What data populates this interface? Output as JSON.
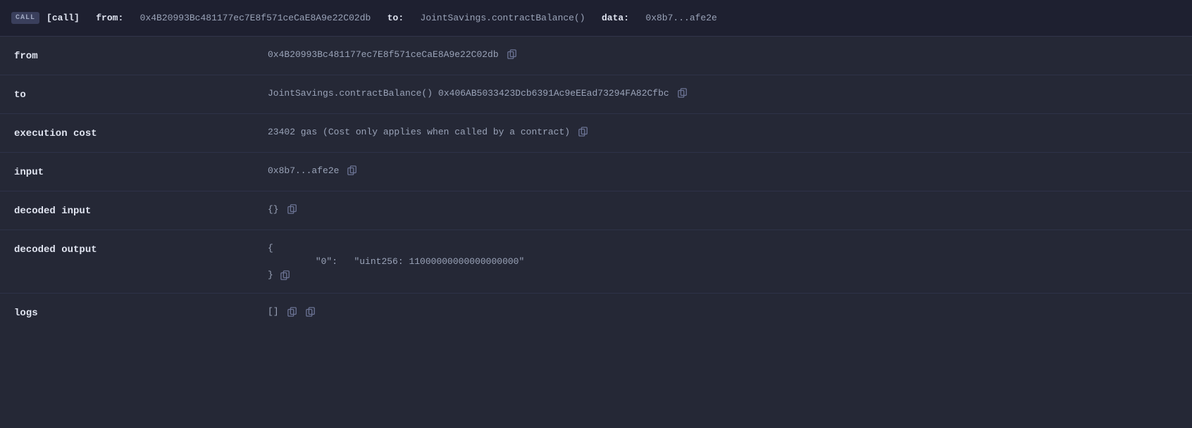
{
  "header": {
    "badge": "CALL",
    "label_call": "[call]",
    "label_from": "from:",
    "from_address": "0x4B20993Bc481177ec7E8f571ceCaE8A9e22C02db",
    "label_to": "to:",
    "to_value": "JointSavings.contractBalance()",
    "label_data": "data:",
    "data_value": "0x8b7...afe2e"
  },
  "rows": {
    "from": {
      "label": "from",
      "value": "0x4B20993Bc481177ec7E8f571ceCaE8A9e22C02db"
    },
    "to": {
      "label": "to",
      "value": "JointSavings.contractBalance()  0x406AB5033423Dcb6391Ac9eEEad73294FA82Cfbc"
    },
    "to_func": "JointSavings.contractBalance()",
    "to_addr": "0x406AB5033423Dcb6391Ac9eEEad73294FA82Cfbc",
    "execution_cost": {
      "label": "execution cost",
      "value": "23402 gas (Cost only applies when called by a contract)"
    },
    "input": {
      "label": "input",
      "value": "0x8b7...afe2e"
    },
    "decoded_input": {
      "label": "decoded input",
      "value": "{}"
    },
    "decoded_output": {
      "label": "decoded output",
      "open_brace": "{",
      "entry_key": "\"0\":",
      "entry_val": "\"uint256: 11000000000000000000\"",
      "close_brace": "}"
    },
    "logs": {
      "label": "logs",
      "value": "[]"
    }
  },
  "icons": {
    "copy": "copy-icon"
  }
}
